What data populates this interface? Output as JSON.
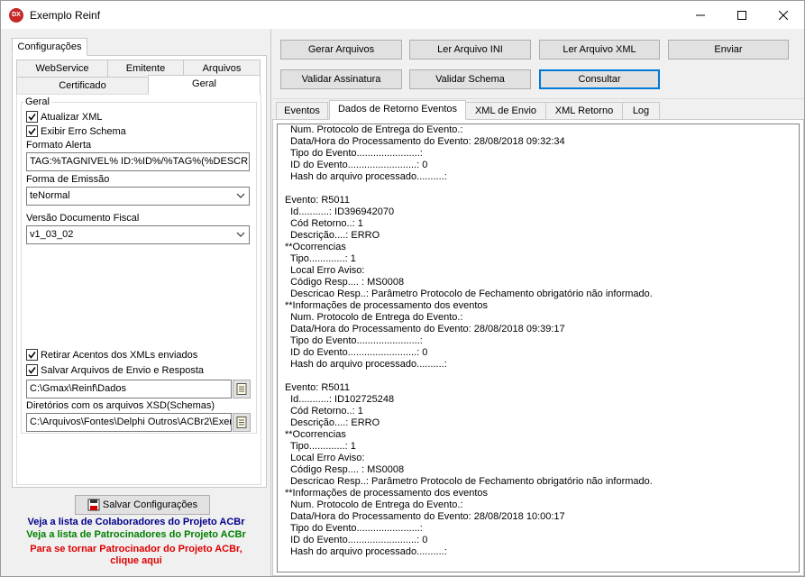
{
  "window": {
    "title": "Exemplo Reinf",
    "icon_text": "DX",
    "controls": [
      "minimize-icon",
      "maximize-icon",
      "close-icon"
    ]
  },
  "left": {
    "page_tab": "Configurações",
    "tabs_row1": [
      "WebService",
      "Emitente",
      "Arquivos"
    ],
    "tabs_row2": [
      "Certificado",
      "Geral"
    ],
    "group_title": "Geral",
    "atualizar_xml": "Atualizar XML",
    "exibir_erro": "Exibir Erro Schema",
    "formato_alerta_label": "Formato Alerta",
    "formato_alerta_value": "TAG:%TAGNIVEL% ID:%ID%/%TAG%(%DESCRI",
    "forma_emissao_label": "Forma de Emissão",
    "forma_emissao_value": "teNormal",
    "versao_label": "Versão Documento Fiscal",
    "versao_value": "v1_03_02",
    "retirar_acentos": "Retirar Acentos dos XMLs enviados",
    "salvar_arquivos": "Salvar Arquivos de Envio e Resposta",
    "path_dados": "C:\\Gmax\\Reinf\\Dados",
    "schemas_label": "Diretórios com os arquivos XSD(Schemas)",
    "path_schemas": "C:\\Arquivos\\Fontes\\Delphi Outros\\ACBr2\\Exer",
    "salvar_config": "Salvar Configurações",
    "link_colaboradores": "Veja a lista de Colaboradores do Projeto ACBr",
    "link_patrocinadores": "Veja a lista de Patrocinadores do Projeto ACBr",
    "link_patrocinar_1": "Para se tornar Patrocinador do Projeto ACBr,",
    "link_patrocinar_2": "clique aqui",
    "colors": {
      "blue": "#00008b",
      "green": "#008000",
      "red": "#e00000"
    }
  },
  "toolbar": {
    "gerar": "Gerar Arquivos",
    "ler_ini": "Ler Arquivo INI",
    "ler_xml": "Ler Arquivo XML",
    "enviar": "Enviar",
    "validar_assinatura": "Validar Assinatura",
    "validar_schema": "Validar Schema",
    "consultar": "Consultar"
  },
  "right_tabs": [
    "Eventos",
    "Dados de Retorno Eventos",
    "XML de Envio",
    "XML Retorno",
    "Log"
  ],
  "memo_lines": [
    "  Num. Protocolo de Entrega do Evento.:",
    "  Data/Hora do Processamento do Evento: 28/08/2018 09:32:34",
    "  Tipo do Evento.......................:",
    "  ID do Evento.........................: 0",
    "  Hash do arquivo processado..........:",
    "",
    "Evento: R5011",
    "  Id...........: ID396942070",
    "  Cód Retorno..: 1",
    "  Descrição....: ERRO",
    "**Ocorrencias",
    "  Tipo.............: 1",
    "  Local Erro Aviso:",
    "  Código Resp.... : MS0008",
    "  Descricao Resp..: Parâmetro Protocolo de Fechamento obrigatório não informado.",
    "**Informações de processamento dos eventos",
    "  Num. Protocolo de Entrega do Evento.:",
    "  Data/Hora do Processamento do Evento: 28/08/2018 09:39:17",
    "  Tipo do Evento.......................:",
    "  ID do Evento.........................: 0",
    "  Hash do arquivo processado..........:",
    "",
    "Evento: R5011",
    "  Id...........: ID102725248",
    "  Cód Retorno..: 1",
    "  Descrição....: ERRO",
    "**Ocorrencias",
    "  Tipo.............: 1",
    "  Local Erro Aviso:",
    "  Código Resp.... : MS0008",
    "  Descricao Resp..: Parâmetro Protocolo de Fechamento obrigatório não informado.",
    "**Informações de processamento dos eventos",
    "  Num. Protocolo de Entrega do Evento.:",
    "  Data/Hora do Processamento do Evento: 28/08/2018 10:00:17",
    "  Tipo do Evento.......................:",
    "  ID do Evento.........................: 0",
    "  Hash do arquivo processado..........:"
  ]
}
